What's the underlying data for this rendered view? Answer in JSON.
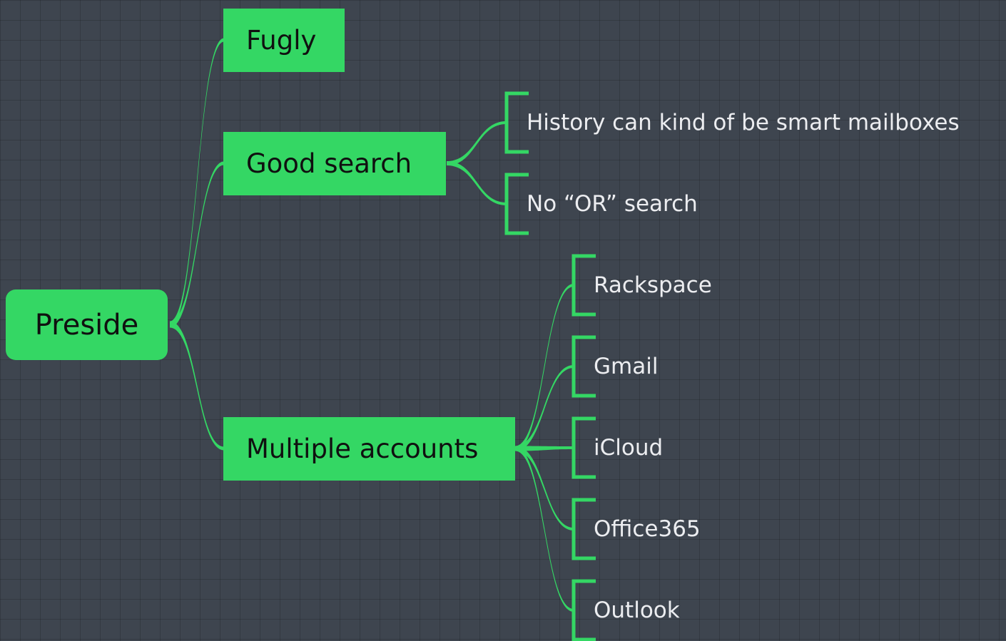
{
  "theme": {
    "accent": "#34d764",
    "background": "#3e454f",
    "node_text_dark": "#101010",
    "node_text_light": "#ecedf0"
  },
  "mindmap": {
    "root": "Preside",
    "topics": [
      {
        "label": "Fugly",
        "children": []
      },
      {
        "label": "Good search",
        "children": [
          "History can kind of be smart mailboxes",
          "No “OR” search"
        ]
      },
      {
        "label": "Multiple accounts",
        "children": [
          "Rackspace",
          "Gmail",
          "iCloud",
          "Office365",
          "Outlook"
        ]
      }
    ]
  }
}
